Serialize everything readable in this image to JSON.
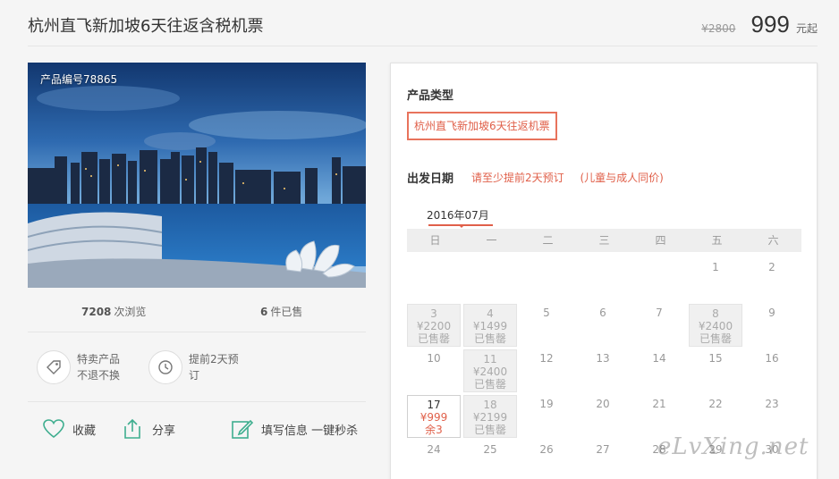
{
  "header": {
    "title": "杭州直飞新加坡6天往返含税机票",
    "old_price": "¥2800",
    "price": "999",
    "price_suffix": "元起"
  },
  "photo": {
    "product_code": "产品编号78865"
  },
  "stats": {
    "views": "7208",
    "views_label": "次浏览",
    "sold": "6",
    "sold_label": "件已售"
  },
  "features": [
    {
      "line1": "特卖产品",
      "line2": "不退不换",
      "icon": "tag-icon"
    },
    {
      "line1": "提前2天预",
      "line2": "订",
      "icon": "clock-icon"
    }
  ],
  "actions": {
    "favorite": "收藏",
    "share": "分享",
    "fill_info": "填写信息 一键秒杀"
  },
  "booking": {
    "type_label": "产品类型",
    "type_option": "杭州直飞新加坡6天往返机票",
    "date_label": "出发日期",
    "note1": "请至少提前2天预订",
    "note2": "(儿童与成人同价)",
    "month": "2016年07月",
    "weekdays": [
      "日",
      "一",
      "二",
      "三",
      "四",
      "五",
      "六"
    ],
    "weeks": [
      [
        {
          "day": ""
        },
        {
          "day": ""
        },
        {
          "day": ""
        },
        {
          "day": ""
        },
        {
          "day": ""
        },
        {
          "day": "1"
        },
        {
          "day": "2"
        }
      ],
      [
        {
          "day": "3",
          "price": "¥2200",
          "status": "已售罄",
          "state": "soldout"
        },
        {
          "day": "4",
          "price": "¥1499",
          "status": "已售罄",
          "state": "soldout"
        },
        {
          "day": "5"
        },
        {
          "day": "6"
        },
        {
          "day": "7"
        },
        {
          "day": "8",
          "price": "¥2400",
          "status": "已售罄",
          "state": "soldout"
        },
        {
          "day": "9"
        }
      ],
      [
        {
          "day": "10"
        },
        {
          "day": "11",
          "price": "¥2400",
          "status": "已售罄",
          "state": "soldout"
        },
        {
          "day": "12"
        },
        {
          "day": "13"
        },
        {
          "day": "14"
        },
        {
          "day": "15"
        },
        {
          "day": "16"
        }
      ],
      [
        {
          "day": "17",
          "price": "¥999",
          "status": "余3",
          "state": "avail"
        },
        {
          "day": "18",
          "price": "¥2199",
          "status": "已售罄",
          "state": "soldout"
        },
        {
          "day": "19"
        },
        {
          "day": "20"
        },
        {
          "day": "21"
        },
        {
          "day": "22"
        },
        {
          "day": "23"
        }
      ],
      [
        {
          "day": "24"
        },
        {
          "day": "25"
        },
        {
          "day": "26"
        },
        {
          "day": "27"
        },
        {
          "day": "28"
        },
        {
          "day": "29"
        },
        {
          "day": "30"
        }
      ]
    ]
  },
  "watermark": "eLvXing.net",
  "colors": {
    "accent": "#e0604a",
    "icon_green": "#3fae8f"
  }
}
